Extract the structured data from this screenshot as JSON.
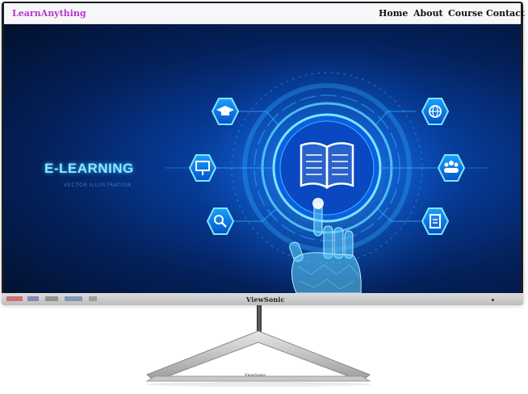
{
  "navbar": {
    "brand": "LearnAnything",
    "links": [
      "Home",
      "About",
      "Course",
      "Contact"
    ]
  },
  "hero": {
    "title": "E-LEARNING",
    "subtitle": "VECTOR ILLUSTRATION"
  },
  "monitor": {
    "brand": "ViewSonic",
    "stand_brand": "ViewSonic"
  },
  "colors": {
    "brand": "#b239c9",
    "hero_glow": "#36b9ff",
    "screen_dark": "#02102c"
  },
  "icons": [
    "graduation-cap-icon",
    "presentation-board-icon",
    "search-icon",
    "globe-icon",
    "people-group-icon",
    "clipboard-icon",
    "book-icon",
    "robot-hand-icon"
  ]
}
